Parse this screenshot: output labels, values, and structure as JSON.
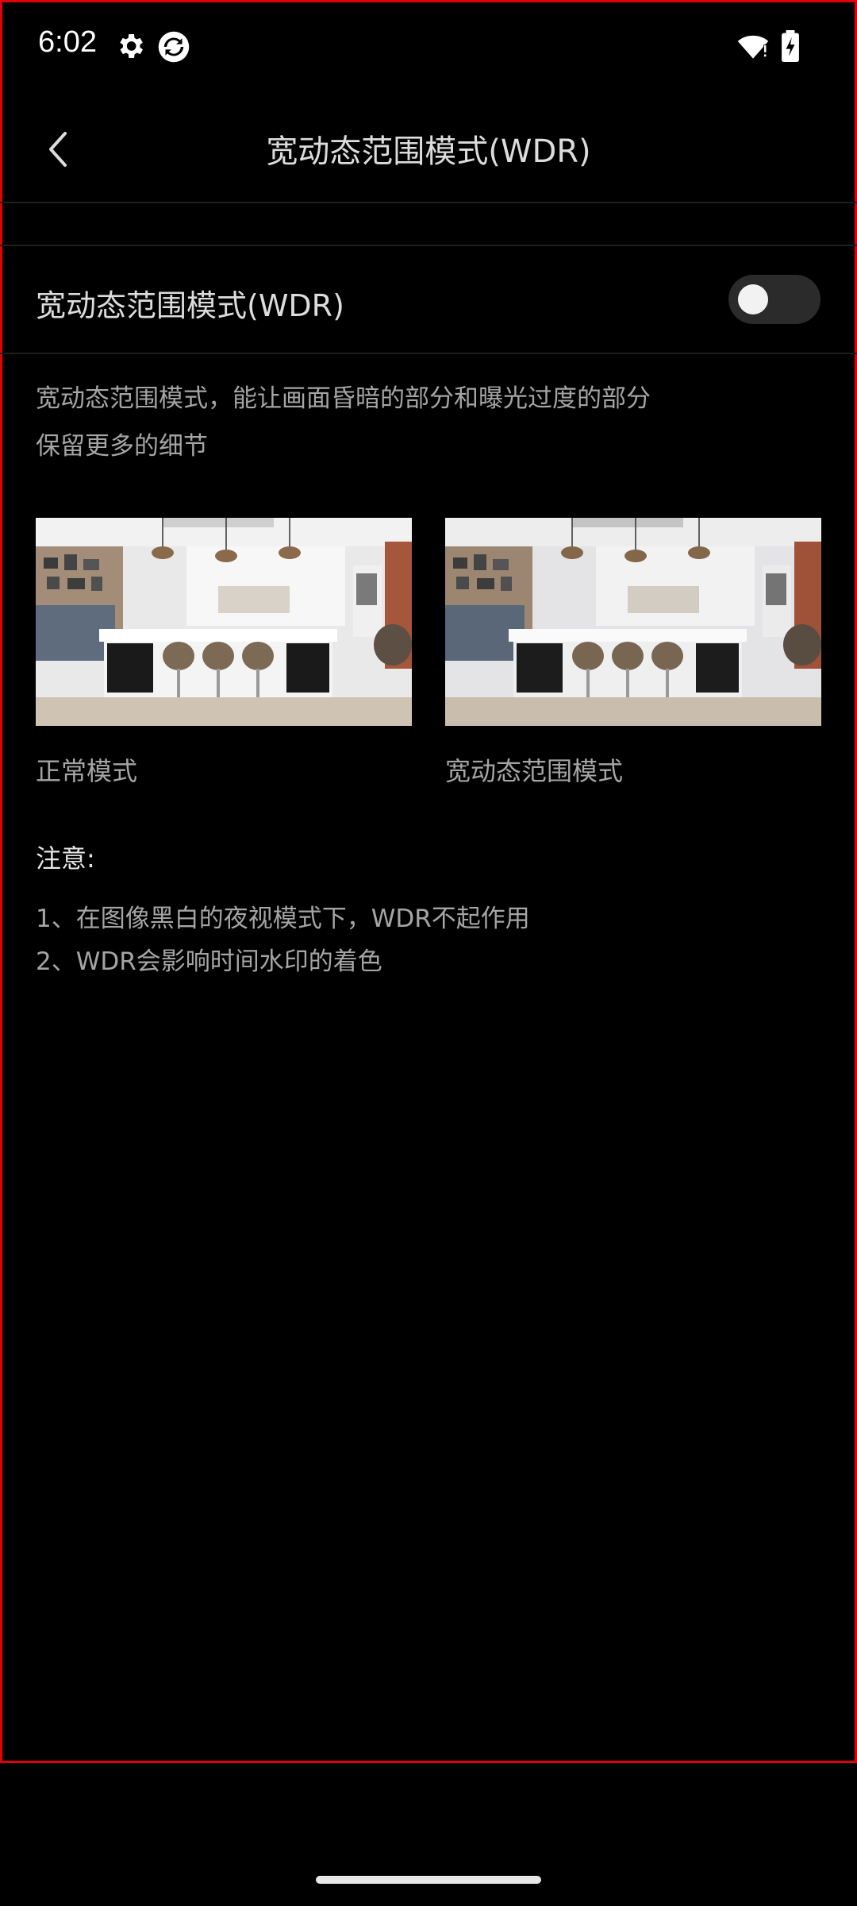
{
  "status_bar": {
    "time": "6:02",
    "left_icons": [
      "gear-icon",
      "sync-app-icon"
    ],
    "right_icons": [
      "wifi-alert-icon",
      "battery-charging-icon"
    ]
  },
  "header": {
    "title": "宽动态范围模式(WDR)",
    "back_icon": "chevron-left-icon"
  },
  "wdr_setting": {
    "label": "宽动态范围模式(WDR)",
    "enabled": false
  },
  "description": {
    "line1": "宽动态范围模式，能让画面昏暗的部分和曝光过度的部分",
    "line2": "保留更多的细节"
  },
  "comparison": {
    "normal_caption": "正常模式",
    "wdr_caption": "宽动态范围模式"
  },
  "notice": {
    "title": "注意:",
    "items": [
      "1、在图像黑白的夜视模式下，WDR不起作用",
      "2、WDR会影响时间水印的着色"
    ]
  },
  "colors": {
    "background": "#000000",
    "frame_border": "#e0000a",
    "switch_off_track": "#2b2b2b"
  }
}
